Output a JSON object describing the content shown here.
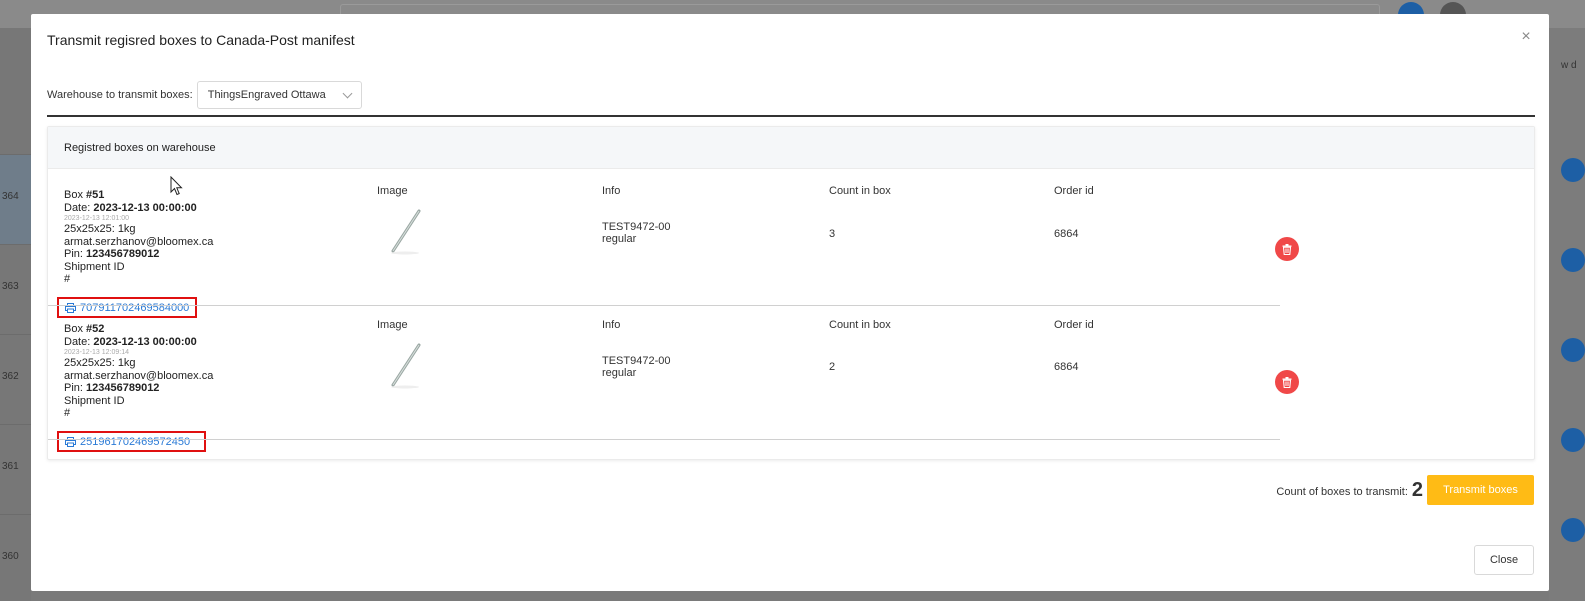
{
  "backdrop": {
    "row_ids": [
      "364",
      "363",
      "362",
      "361",
      "360"
    ],
    "header_partial": "w d"
  },
  "modal": {
    "title": "Transmit regisred boxes to Canada-Post manifest",
    "close_icon": "×"
  },
  "warehouse": {
    "label": "Warehouse to transmit boxes:",
    "selected": "ThingsEngraved Ottawa"
  },
  "card": {
    "title": "Registred boxes on warehouse"
  },
  "columns": {
    "image": "Image",
    "info": "Info",
    "count": "Count in box",
    "order": "Order id"
  },
  "boxes": [
    {
      "box_prefix": "Box ",
      "box_no": "#51",
      "date_label": "Date: ",
      "date": "2023-12-13 00:00:00",
      "timestamp": "2023-12-13 12:01:00",
      "dims": "25x25x25: 1kg",
      "email": "armat.serzhanov@bloomex.ca",
      "pin_label": "Pin: ",
      "pin": "123456789012",
      "shipment_label": "Shipment ID",
      "hash": "#",
      "tracking": "707911702469584000",
      "info_line1": "TEST9472-00",
      "info_line2": "regular",
      "count": "3",
      "order_id": "6864"
    },
    {
      "box_prefix": "Box ",
      "box_no": "#52",
      "date_label": "Date: ",
      "date": "2023-12-13 00:00:00",
      "timestamp": "2023-12-13 12:09:14",
      "dims": "25x25x25: 1kg",
      "email": "armat.serzhanov@bloomex.ca",
      "pin_label": "Pin: ",
      "pin": "123456789012",
      "shipment_label": "Shipment ID",
      "hash": "#",
      "tracking": "251961702469572450",
      "info_line1": "TEST9472-00",
      "info_line2": "regular",
      "count": "2",
      "order_id": "6864"
    }
  ],
  "footer": {
    "count_label": "Count of boxes to transmit:",
    "count_value": "2",
    "transmit_label": "Transmit boxes",
    "close_label": "Close"
  },
  "colors": {
    "accent": "#ffbb15",
    "danger": "#f04848",
    "link": "#2a7ad6",
    "highlight": "#e01010"
  }
}
